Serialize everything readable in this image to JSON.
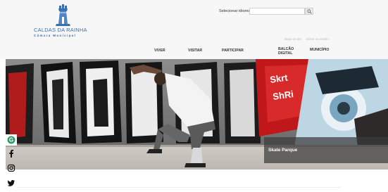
{
  "header": {
    "logo_name": "CALDAS DA RAINHA",
    "logo_subtitle": "Câmara Municipal",
    "language_label": "Selecionar idioma",
    "search_placeholder": "",
    "util_links": [
      "Mapa do site",
      "Entrar na sessão"
    ]
  },
  "nav": {
    "items": [
      {
        "label": "VIVER"
      },
      {
        "label": "VISITAR"
      },
      {
        "label": "PARTICIPAR"
      },
      {
        "label_line1": "BALCÃO",
        "label_line2": "DIGITAL"
      },
      {
        "label": "MUNICÍPIO"
      }
    ]
  },
  "hero": {
    "caption": "Skate Parque"
  },
  "social": [
    "google-icon",
    "facebook-icon",
    "instagram-icon",
    "twitter-icon"
  ],
  "colors": {
    "brand_blue": "#3a6fb0",
    "header_bg": "#f7f7f7",
    "caption_bg": "#3c3c3c"
  }
}
